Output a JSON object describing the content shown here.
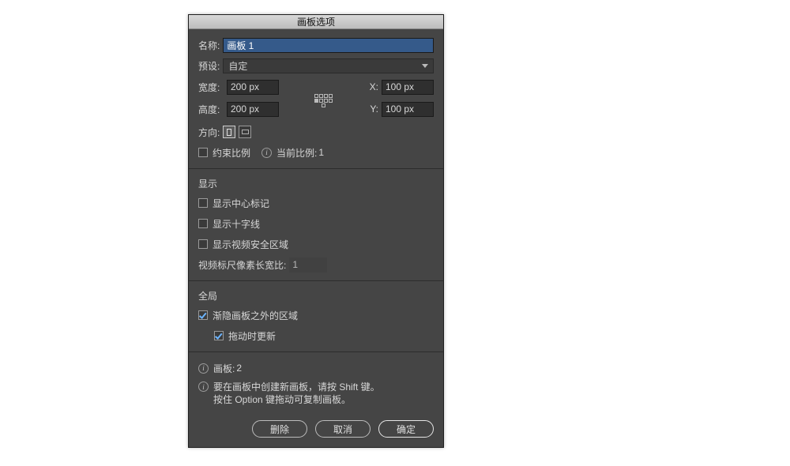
{
  "dialog": {
    "title": "画板选项",
    "name_label": "名称:",
    "name_value": "画板 1",
    "preset_label": "预设:",
    "preset_value": "自定",
    "width_label": "宽度:",
    "width_value": "200 px",
    "height_label": "高度:",
    "height_value": "200 px",
    "x_label": "X:",
    "x_value": "100 px",
    "y_label": "Y:",
    "y_value": "100 px",
    "orient_label": "方向:",
    "constrain_label": "约束比例",
    "ratio_label": "当前比例:",
    "ratio_value": "1",
    "display_header": "显示",
    "opt_center": "显示中心标记",
    "opt_cross": "显示十字线",
    "opt_safe": "显示视频安全区域",
    "pixel_ratio_label": "视频标尺像素长宽比:",
    "pixel_ratio_value": "1",
    "global_header": "全局",
    "fade_label": "渐隐画板之外的区域",
    "drag_update_label": "拖动时更新",
    "artboards_label": "画板:",
    "artboards_value": "2",
    "hint_line1": "要在画板中创建新画板，请按 Shift 键。",
    "hint_line2": "按住 Option 键拖动可复制画板。",
    "delete_btn": "删除",
    "cancel_btn": "取消",
    "ok_btn": "确定"
  }
}
